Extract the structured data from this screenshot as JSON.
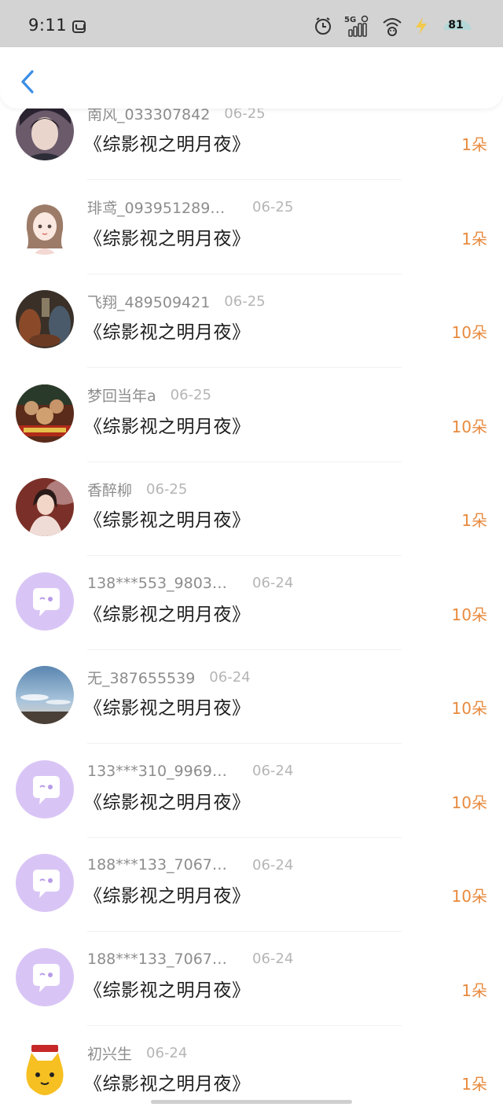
{
  "status_bar": {
    "time": "9:11",
    "battery": "81",
    "icons": [
      "app-switch-icon",
      "alarm-icon",
      "5g-signal-icon",
      "wifi-icon",
      "charging-bolt-icon",
      "battery-icon"
    ]
  },
  "header": {
    "back_icon": "chevron-left-icon",
    "accent_color": "#3a8ee6"
  },
  "colors": {
    "amount": "#e88a3e",
    "username": "#8d8d8d",
    "date": "#b5b5b5",
    "default_avatar_bg": "#d9c5f5"
  },
  "gifts": [
    {
      "user": "南风_033307842",
      "date": "06-25",
      "title": "《综影视之明月夜》",
      "amount": "1朵",
      "avatar": "photo-girl-portrait"
    },
    {
      "user": "琲鸢_093951289…",
      "date": "06-25",
      "title": "《综影视之明月夜》",
      "amount": "1朵",
      "avatar": "cartoon-girl"
    },
    {
      "user": "飞翔_489509421",
      "date": "06-25",
      "title": "《综影视之明月夜》",
      "amount": "10朵",
      "avatar": "poster-dark"
    },
    {
      "user": "梦回当年a",
      "date": "06-25",
      "title": "《综影视之明月夜》",
      "amount": "10朵",
      "avatar": "poster-movie"
    },
    {
      "user": "香醉柳",
      "date": "06-25",
      "title": "《综影视之明月夜》",
      "amount": "1朵",
      "avatar": "photo-woman"
    },
    {
      "user": "138***553_9803…",
      "date": "06-24",
      "title": "《综影视之明月夜》",
      "amount": "10朵",
      "avatar": "default-chat-bubble"
    },
    {
      "user": "无_387655539",
      "date": "06-24",
      "title": "《综影视之明月夜》",
      "amount": "10朵",
      "avatar": "photo-sky"
    },
    {
      "user": "133***310_9969…",
      "date": "06-24",
      "title": "《综影视之明月夜》",
      "amount": "10朵",
      "avatar": "default-chat-bubble"
    },
    {
      "user": "188***133_7067…",
      "date": "06-24",
      "title": "《综影视之明月夜》",
      "amount": "10朵",
      "avatar": "default-chat-bubble"
    },
    {
      "user": "188***133_7067…",
      "date": "06-24",
      "title": "《综影视之明月夜》",
      "amount": "1朵",
      "avatar": "default-chat-bubble"
    },
    {
      "user": "初兴生",
      "date": "06-24",
      "title": "《综影视之明月夜》",
      "amount": "1朵",
      "avatar": "cartoon-yellow-cat"
    }
  ]
}
